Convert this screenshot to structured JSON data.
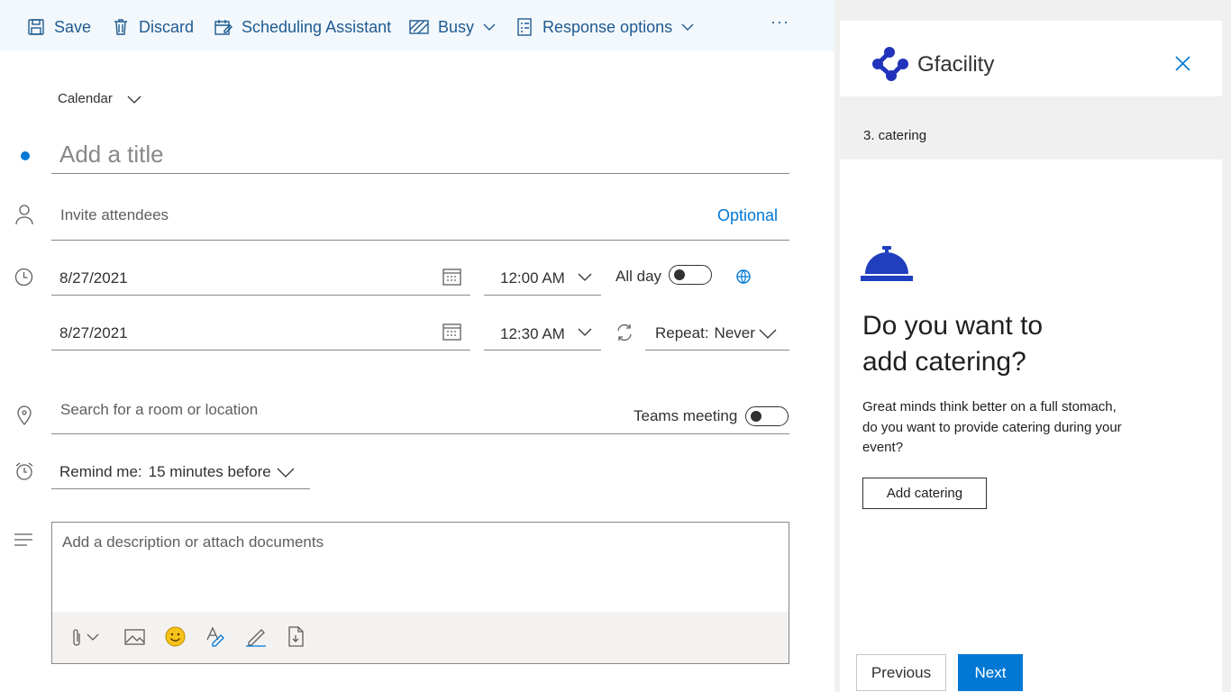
{
  "toolbar": {
    "save_label": "Save",
    "discard_label": "Discard",
    "scheduling_label": "Scheduling Assistant",
    "busy_label": "Busy",
    "response_label": "Response options",
    "more_label": "···"
  },
  "form": {
    "calendar_label": "Calendar",
    "title_placeholder": "Add a title",
    "attendees_placeholder": "Invite attendees",
    "optional_label": "Optional",
    "start_date": "8/27/2021",
    "start_time": "12:00 AM",
    "all_day_label": "All day",
    "all_day_on": false,
    "end_date": "8/27/2021",
    "end_time": "12:30 AM",
    "repeat_label": "Repeat:",
    "repeat_value": "Never",
    "location_placeholder": "Search for a room or location",
    "teams_label": "Teams meeting",
    "teams_on": false,
    "remind_label": "Remind me:",
    "remind_value": "15 minutes before",
    "description_placeholder": "Add a description or attach documents"
  },
  "addin": {
    "app_name": "Gfacility",
    "step_label": "3. catering",
    "heading_line1": "Do you want to",
    "heading_line2": "add catering?",
    "body_line1": "Great minds think better on a full stomach,",
    "body_line2": "do you want to provide catering during your",
    "body_line3": "event?",
    "add_button": "Add catering",
    "previous_button": "Previous",
    "next_button": "Next"
  },
  "colors": {
    "accent": "#0078d4",
    "toolbar_text": "#1e5a91",
    "brand": "#2233bb",
    "bell": "#1f3fbf"
  }
}
